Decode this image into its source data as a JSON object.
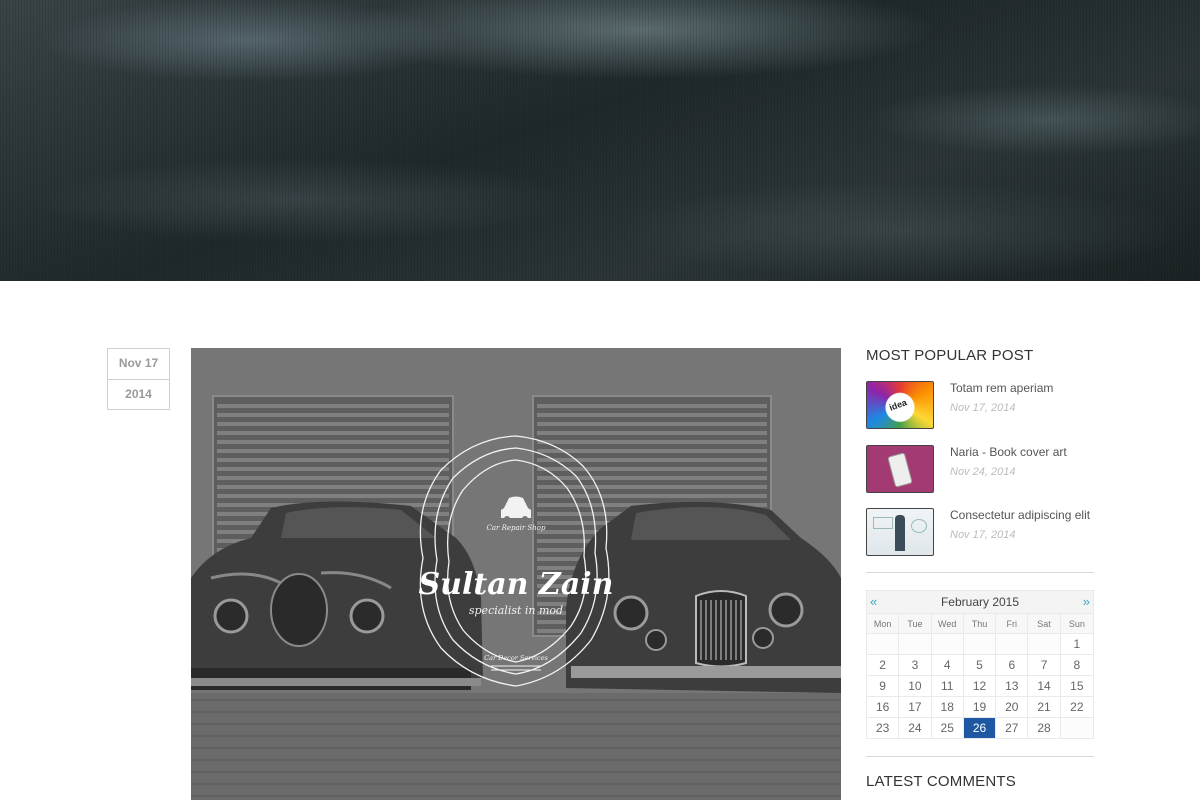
{
  "post": {
    "date_day": "Nov 17",
    "date_year": "2014",
    "image": {
      "logo_tagline": "Car Repair Shop",
      "logo_name": "Sultan Zain",
      "logo_sub": "specialist in mod",
      "logo_footer": "Car Decor Services"
    }
  },
  "sidebar": {
    "popular_title": "MOST POPULAR POST",
    "popular_posts": [
      {
        "title": "Totam rem aperiam",
        "date": "Nov 17, 2014",
        "thumb": "idea-thumbnail"
      },
      {
        "title": "Naria - Book cover art",
        "date": "Nov 24, 2014",
        "thumb": "phone-thumbnail"
      },
      {
        "title": "Consectetur adipiscing elit",
        "date": "Nov 17, 2014",
        "thumb": "whiteboard-thumbnail"
      }
    ],
    "calendar": {
      "prev": "«",
      "next": "»",
      "month": "February 2015",
      "weekdays": [
        "Mon",
        "Tue",
        "Wed",
        "Thu",
        "Fri",
        "Sat",
        "Sun"
      ],
      "leading_blanks": 6,
      "days": [
        "1",
        "2",
        "3",
        "4",
        "5",
        "6",
        "7",
        "8",
        "9",
        "10",
        "11",
        "12",
        "13",
        "14",
        "15",
        "16",
        "17",
        "18",
        "19",
        "20",
        "21",
        "22",
        "23",
        "24",
        "25",
        "26",
        "27",
        "28"
      ],
      "highlighted_day": "26",
      "trailing_blanks": 1
    },
    "latest_comments_title": "LATEST COMMENTS"
  },
  "colors": {
    "accent": "#1e58a3",
    "nav_arrow": "#3aa8c1"
  }
}
